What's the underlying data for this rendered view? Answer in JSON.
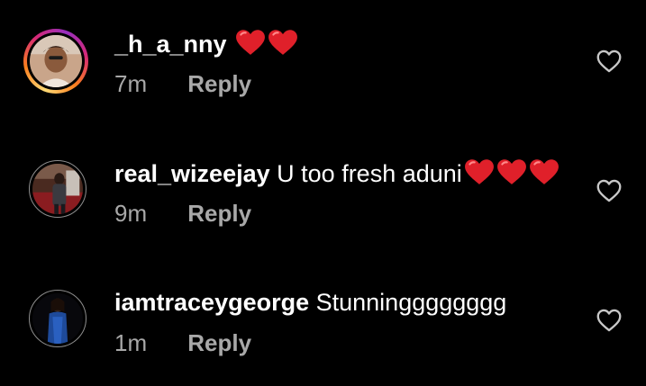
{
  "colors": {
    "background": "#000000",
    "text": "#ffffff",
    "muted": "#a8a8a8",
    "heart": "#e0202a",
    "story_ring": [
      "#feda75",
      "#fa7e1e",
      "#d62976",
      "#962fbf"
    ]
  },
  "comments": [
    {
      "username": "_h_a_nny",
      "text": "",
      "emoji": [
        "red-heart",
        "red-heart"
      ],
      "time": "7m",
      "reply_label": "Reply",
      "like_icon": "heart-outline-icon",
      "avatar_ring": "story"
    },
    {
      "username": "real_wizeejay",
      "text": "U too fresh aduni",
      "emoji": [
        "red-heart",
        "red-heart",
        "red-heart"
      ],
      "time": "9m",
      "reply_label": "Reply",
      "like_icon": "heart-outline-icon",
      "avatar_ring": "plain"
    },
    {
      "username": "iamtraceygeorge",
      "text": "Stunningggggggg",
      "emoji": [],
      "time": "1m",
      "reply_label": "Reply",
      "like_icon": "heart-outline-icon",
      "avatar_ring": "plain"
    }
  ]
}
